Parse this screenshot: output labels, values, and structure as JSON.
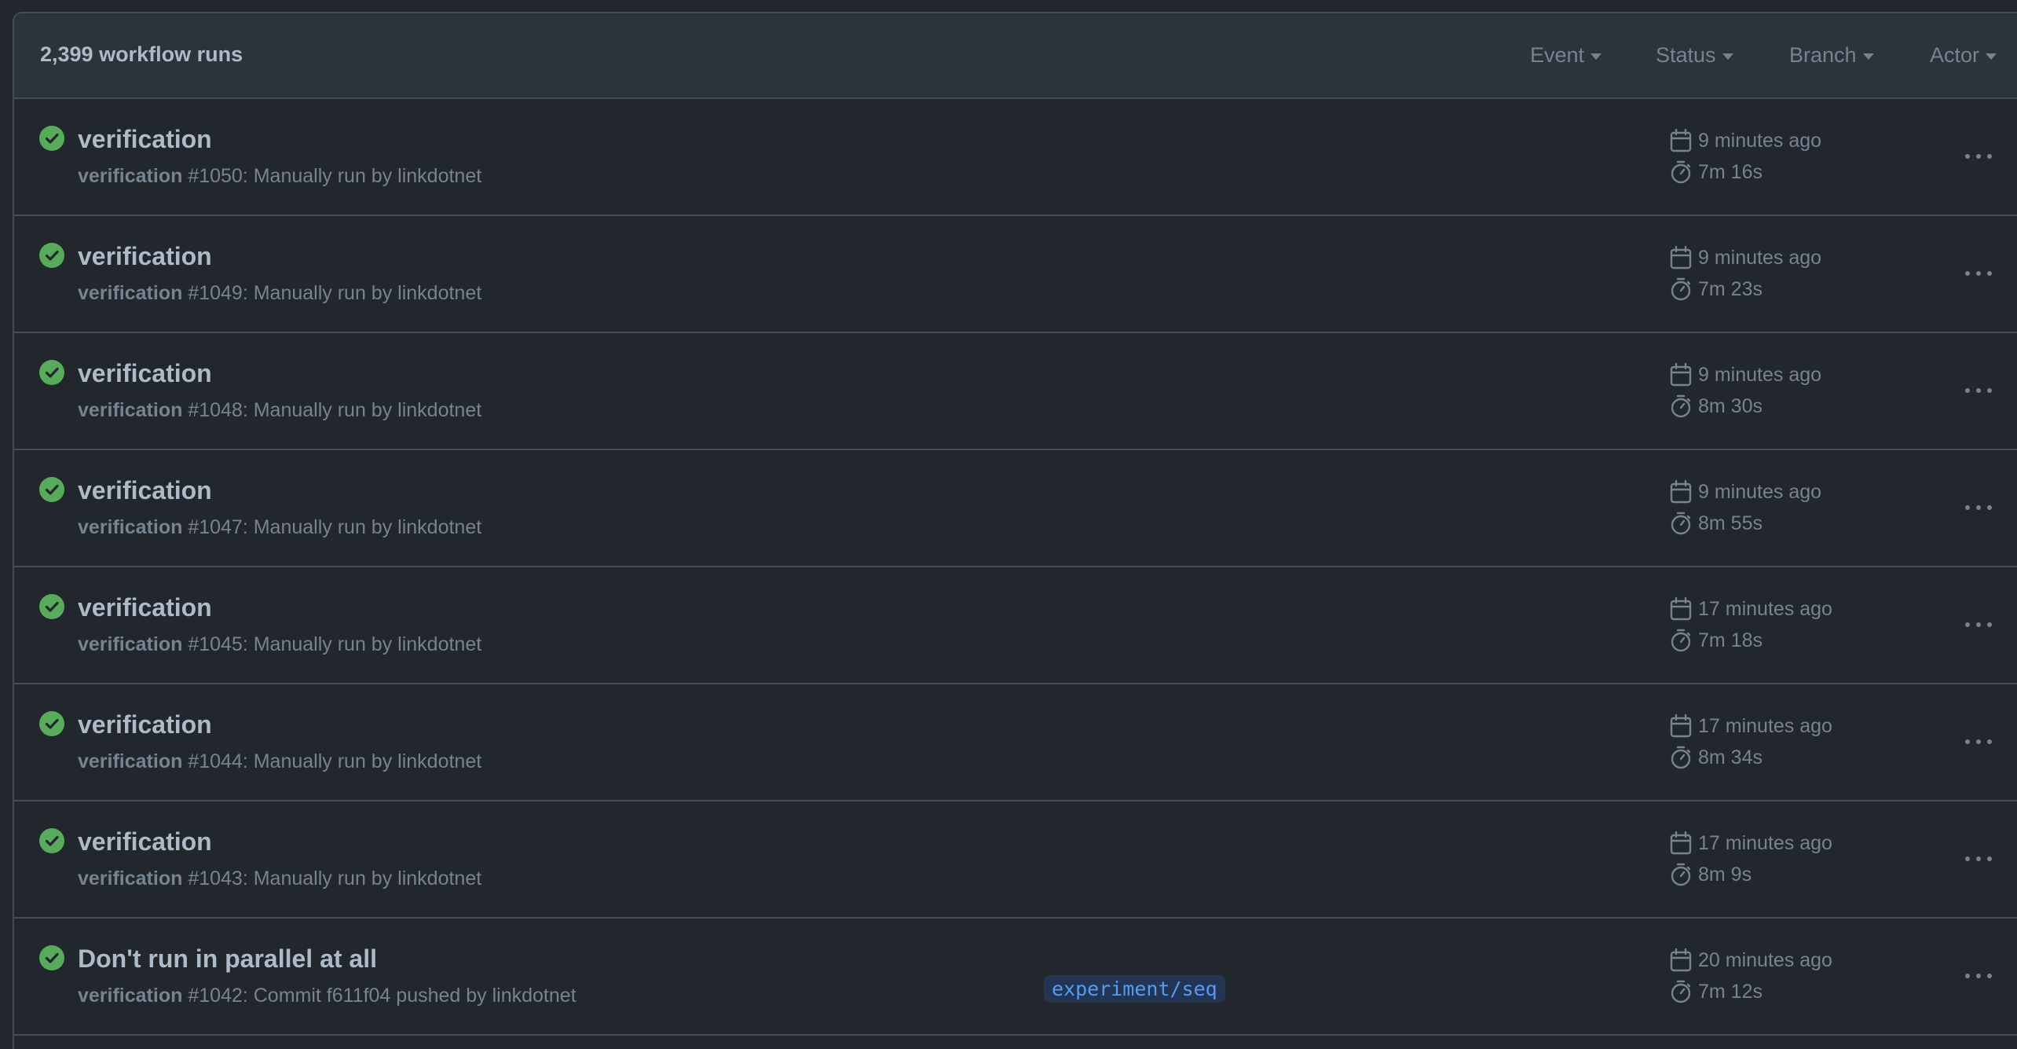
{
  "header": {
    "run_count": "2,399 workflow runs",
    "filters": {
      "event": "Event",
      "status": "Status",
      "branch": "Branch",
      "actor": "Actor"
    }
  },
  "colors": {
    "success": "#57ab5a",
    "branch_text": "#539bf5"
  },
  "runs": [
    {
      "title": "verification",
      "workflow": "verification",
      "detail": " #1050: Manually run by linkdotnet",
      "time": "9 minutes ago",
      "duration": "7m 16s",
      "status": "success"
    },
    {
      "title": "verification",
      "workflow": "verification",
      "detail": " #1049: Manually run by linkdotnet",
      "time": "9 minutes ago",
      "duration": "7m 23s",
      "status": "success"
    },
    {
      "title": "verification",
      "workflow": "verification",
      "detail": " #1048: Manually run by linkdotnet",
      "time": "9 minutes ago",
      "duration": "8m 30s",
      "status": "success"
    },
    {
      "title": "verification",
      "workflow": "verification",
      "detail": " #1047: Manually run by linkdotnet",
      "time": "9 minutes ago",
      "duration": "8m 55s",
      "status": "success"
    },
    {
      "title": "verification",
      "workflow": "verification",
      "detail": " #1045: Manually run by linkdotnet",
      "time": "17 minutes ago",
      "duration": "7m 18s",
      "status": "success"
    },
    {
      "title": "verification",
      "workflow": "verification",
      "detail": " #1044: Manually run by linkdotnet",
      "time": "17 minutes ago",
      "duration": "8m 34s",
      "status": "success"
    },
    {
      "title": "verification",
      "workflow": "verification",
      "detail": " #1043: Manually run by linkdotnet",
      "time": "17 minutes ago",
      "duration": "8m 9s",
      "status": "success"
    },
    {
      "title": "Don't run in parallel at all",
      "workflow": "verification",
      "detail": " #1042: Commit f611f04 pushed by linkdotnet",
      "branch": "experiment/seq",
      "time": "20 minutes ago",
      "duration": "7m 12s",
      "status": "success"
    }
  ]
}
